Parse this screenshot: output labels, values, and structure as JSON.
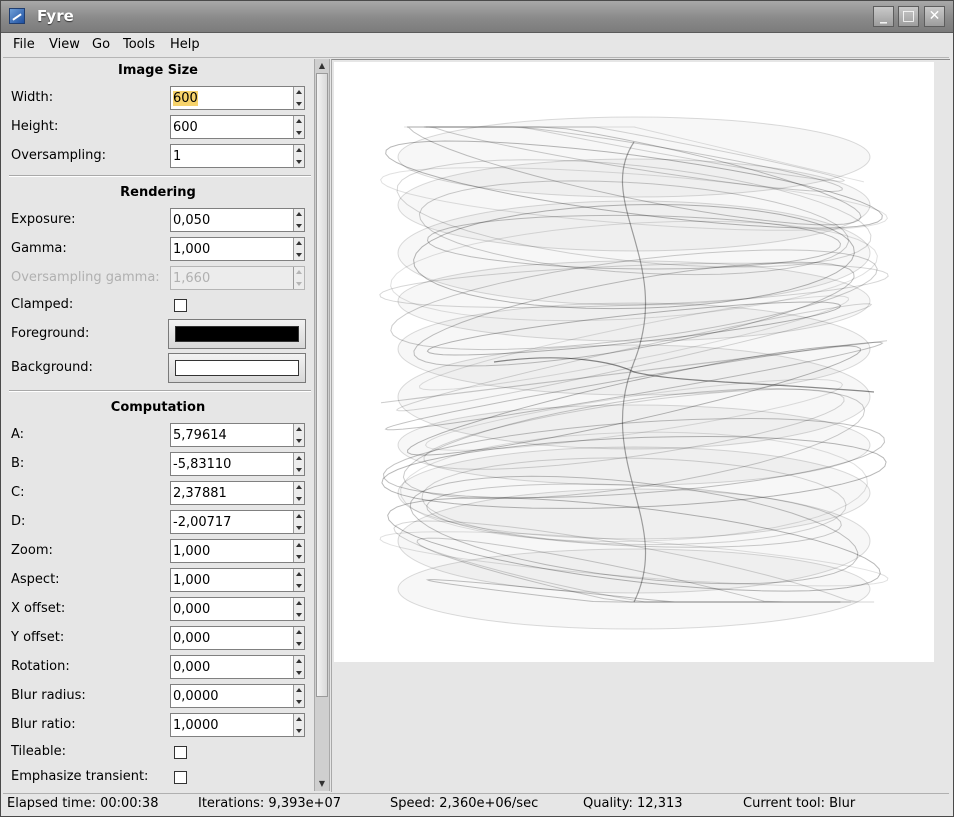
{
  "window": {
    "title": "Fyre"
  },
  "menubar": {
    "items": [
      "File",
      "View",
      "Go",
      "Tools",
      "Help"
    ]
  },
  "sections": {
    "image_size": "Image Size",
    "rendering": "Rendering",
    "computation": "Computation"
  },
  "fields": {
    "width": {
      "label": "Width:",
      "value": "600"
    },
    "height": {
      "label": "Height:",
      "value": "600"
    },
    "oversampling": {
      "label": "Oversampling:",
      "value": "1"
    },
    "exposure": {
      "label": "Exposure:",
      "value": "0,050"
    },
    "gamma": {
      "label": "Gamma:",
      "value": "1,000"
    },
    "oversampling_gamma": {
      "label": "Oversampling gamma:",
      "value": "1,660"
    },
    "clamped": {
      "label": "Clamped:"
    },
    "foreground": {
      "label": "Foreground:",
      "color": "#000000"
    },
    "background": {
      "label": "Background:",
      "color": "#ffffff"
    },
    "a": {
      "label": "A:",
      "value": "5,79614"
    },
    "b": {
      "label": "B:",
      "value": "-5,83110"
    },
    "c": {
      "label": "C:",
      "value": "2,37881"
    },
    "d": {
      "label": "D:",
      "value": "-2,00717"
    },
    "zoom": {
      "label": "Zoom:",
      "value": "1,000"
    },
    "aspect": {
      "label": "Aspect:",
      "value": "1,000"
    },
    "x_offset": {
      "label": "X offset:",
      "value": "0,000"
    },
    "y_offset": {
      "label": "Y offset:",
      "value": "0,000"
    },
    "rotation": {
      "label": "Rotation:",
      "value": "0,000"
    },
    "blur_radius": {
      "label": "Blur radius:",
      "value": "0,0000"
    },
    "blur_ratio": {
      "label": "Blur ratio:",
      "value": "1,0000"
    },
    "tileable": {
      "label": "Tileable:"
    },
    "emphasize_transient": {
      "label": "Emphasize transient:"
    }
  },
  "status": {
    "elapsed": "Elapsed time: 00:00:38",
    "iterations": "Iterations: 9,393e+07",
    "speed": "Speed: 2,360e+06/sec",
    "quality": "Quality: 12,313",
    "tool": "Current tool: Blur"
  },
  "icons": {
    "minimize": "minimize-icon",
    "maximize": "maximize-icon",
    "close": "close-icon"
  }
}
